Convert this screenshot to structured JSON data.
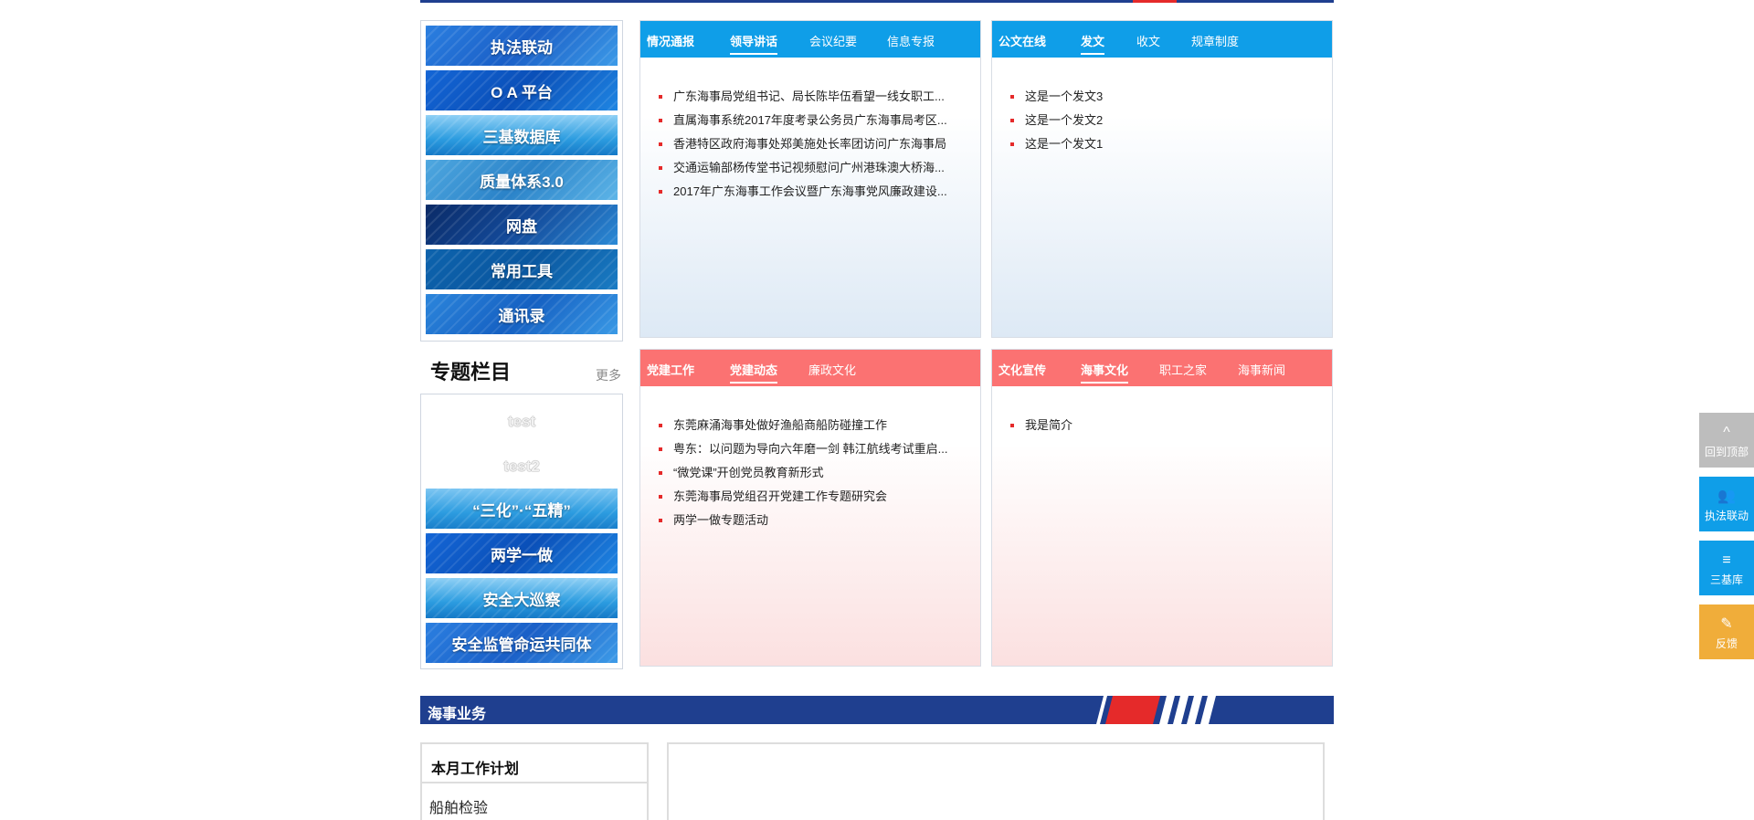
{
  "quick_links": [
    {
      "label": "执法联动"
    },
    {
      "label": "O A 平台"
    },
    {
      "label": "三基数据库"
    },
    {
      "label": "质量体系3.0"
    },
    {
      "label": "网盘"
    },
    {
      "label": "常用工具"
    },
    {
      "label": "通讯录"
    }
  ],
  "special": {
    "title": "专题栏目",
    "more": "更多",
    "items": [
      {
        "label": "test"
      },
      {
        "label": "test2"
      },
      {
        "label": "“三化”·“五精”"
      },
      {
        "label": "两学一做"
      },
      {
        "label": "安全大巡察"
      },
      {
        "label": "安全监管命运共同体"
      }
    ]
  },
  "panels": {
    "situation": {
      "title": "情况通报",
      "tabs": [
        "领导讲话",
        "会议纪要",
        "信息专报"
      ],
      "items": [
        "广东海事局党组书记、局长陈毕伍看望一线女职工...",
        "直属海事系统2017年度考录公务员广东海事局考区...",
        "香港特区政府海事处郑美施处长率团访问广东海事局",
        "交通运输部杨传堂书记视频慰问广州港珠澳大桥海...",
        "2017年广东海事工作会议暨广东海事党风廉政建设..."
      ]
    },
    "documents": {
      "title": "公文在线",
      "tabs": [
        "发文",
        "收文",
        "规章制度"
      ],
      "items": [
        "这是一个发文3",
        "这是一个发文2",
        "这是一个发文1"
      ]
    },
    "party": {
      "title": "党建工作",
      "tabs": [
        "党建动态",
        "廉政文化"
      ],
      "items": [
        "东莞麻涌海事处做好渔船商船防碰撞工作",
        "粤东：以问题为导向六年磨一剑 韩江航线考试重启...",
        "“微党课”开创党员教育新形式",
        "东莞海事局党组召开党建工作专题研究会",
        "两学一做专题活动"
      ]
    },
    "culture": {
      "title": "文化宣传",
      "tabs": [
        "海事文化",
        "职工之家",
        "海事新闻"
      ],
      "items": [
        "我是简介"
      ]
    }
  },
  "marine": {
    "title": "海事业务",
    "plan_title": "本月工作计划",
    "plan_item": "船舶检验"
  },
  "float_buttons": [
    {
      "label": "回到顶部",
      "icon": "^",
      "color": "#bdbdbd"
    },
    {
      "label": "执法联动",
      "icon": "👥",
      "color": "#0f9ee8"
    },
    {
      "label": "三基库",
      "icon": "≡",
      "color": "#0f9ee8"
    },
    {
      "label": "反馈",
      "icon": "✎",
      "color": "#f0ad3a"
    }
  ]
}
